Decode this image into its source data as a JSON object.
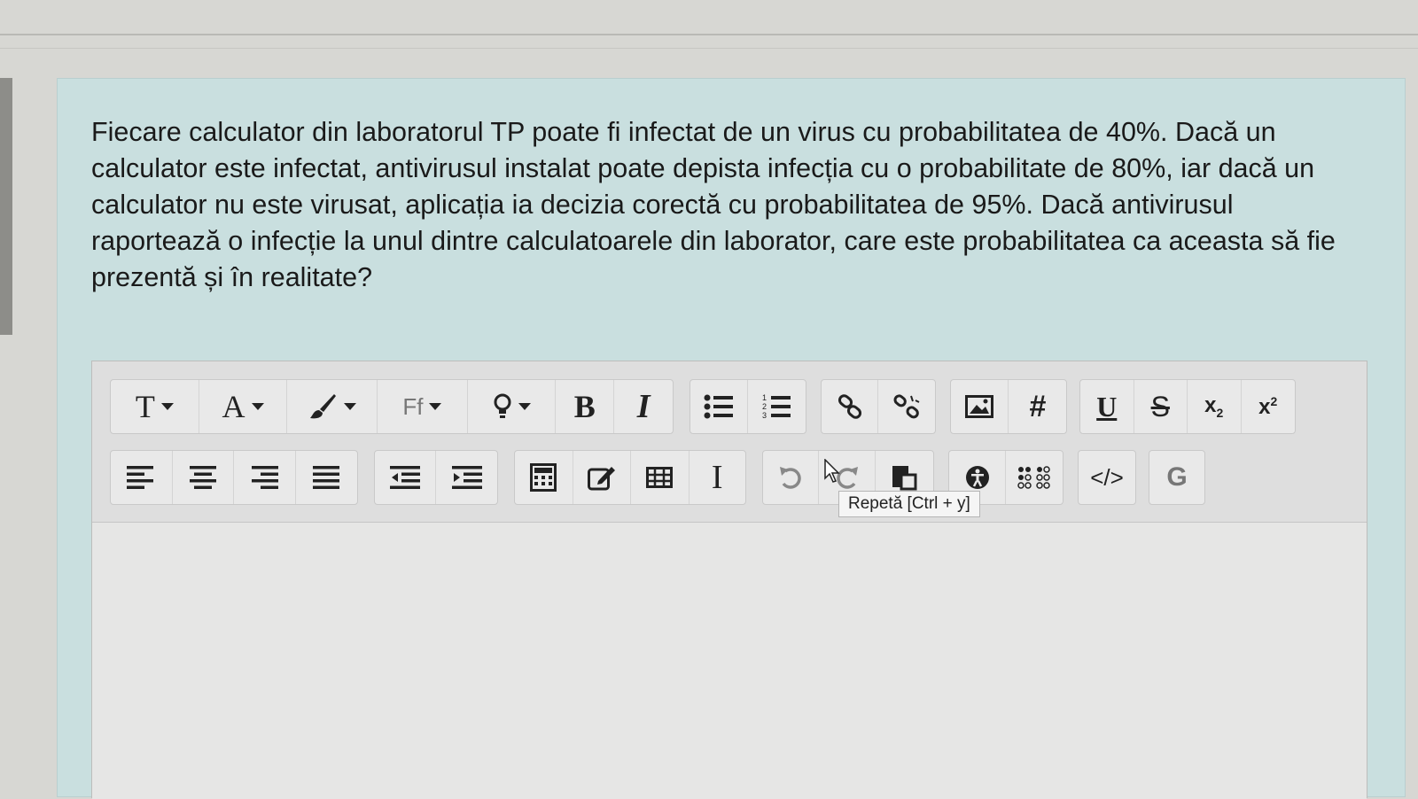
{
  "question": {
    "text": "Fiecare calculator din laboratorul TP poate fi infectat de un virus cu probabilitatea de 40%. Dacă un calculator este infectat, antivirusul instalat poate depista infecția cu o probabilitate de 80%, iar dacă un calculator nu este virusat, aplicația ia decizia corectă cu probabilitatea de 95%. Dacă antivirusul raportează o infecție la unul dintre calculatoarele din laborator, care este probabilitatea ca aceasta să fie prezentă și în realitate?"
  },
  "toolbar": {
    "row1": {
      "text_style": "T",
      "font_color": "A",
      "font_family": "Ff",
      "bold": "B",
      "italic": "I",
      "underline": "U",
      "strike": "S",
      "subscript": "x",
      "subscript_num": "2",
      "superscript": "x",
      "superscript_num": "2",
      "hash": "#"
    },
    "row2": {
      "spell": "G",
      "code": "</>",
      "cursor_icon": "I"
    },
    "tooltip": "Repetă [Ctrl + y]"
  },
  "colors": {
    "card_bg": "#c9dfdf",
    "toolbar_bg": "#dedede",
    "button_bg": "#e9e9e9",
    "text": "#1a1a1a"
  }
}
